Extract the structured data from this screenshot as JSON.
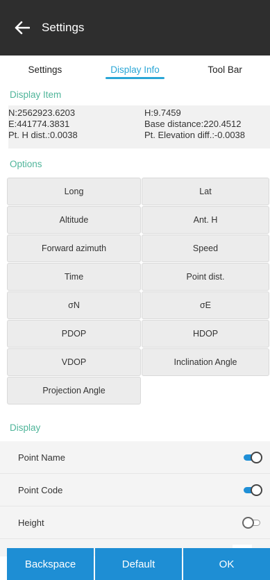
{
  "header": {
    "title": "Settings"
  },
  "tabs": [
    {
      "label": "Settings",
      "active": false
    },
    {
      "label": "Display Info",
      "active": true
    },
    {
      "label": "Tool Bar",
      "active": false
    }
  ],
  "display_item": {
    "title": "Display Item",
    "left": [
      "N:2562923.6203",
      "E:441774.3831",
      "Pt. H dist.:0.0038"
    ],
    "right": [
      "H:9.7459",
      "Base distance:220.4512",
      "Pt. Elevation diff.:-0.0038"
    ]
  },
  "options": {
    "title": "Options",
    "items": [
      "Long",
      "Lat",
      "Altitude",
      "Ant. H",
      "Forward azimuth",
      "Speed",
      "Time",
      "Point dist.",
      "σN",
      "σE",
      "PDOP",
      "HDOP",
      "VDOP",
      "Inclination Angle",
      "Projection Angle"
    ]
  },
  "display": {
    "title": "Display",
    "rows": [
      {
        "label": "Point Name",
        "on": true
      },
      {
        "label": "Point Code",
        "on": true
      },
      {
        "label": "Height",
        "on": false
      }
    ]
  },
  "footer": {
    "backspace": "Backspace",
    "default": "Default",
    "ok": "OK"
  },
  "colors": {
    "accent": "#2aa6d6",
    "section": "#4fb59a",
    "button": "#1e8ed4",
    "titlebar": "#2e2e2e"
  }
}
